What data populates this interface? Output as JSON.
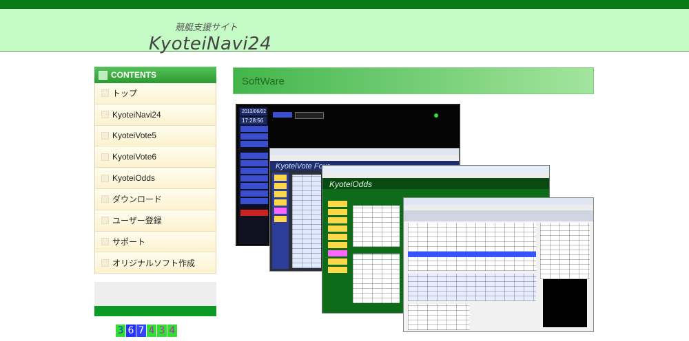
{
  "header": {
    "subtitle": "競艇支援サイト",
    "title": "KyoteiNavi24"
  },
  "sidebar": {
    "heading": "CONTENTS",
    "items": [
      {
        "label": "トップ"
      },
      {
        "label": "KyoteiNavi24"
      },
      {
        "label": "KyoteiVote5"
      },
      {
        "label": "KyoteiVote6"
      },
      {
        "label": "KyoteiOdds"
      },
      {
        "label": "ダウンロード"
      },
      {
        "label": "ユーザー登録"
      },
      {
        "label": "サポート"
      },
      {
        "label": "オリジナルソフト作成"
      }
    ]
  },
  "counter": {
    "digits": [
      "3",
      "6",
      "7",
      "4",
      "3",
      "4"
    ]
  },
  "main": {
    "section_title": "SoftWare",
    "screens": {
      "vote": {
        "logo": "KyoteiVote Four"
      },
      "odds": {
        "logo": "KyoteiOdds"
      },
      "navi": {
        "time": "17:28:56"
      }
    }
  },
  "colors": {
    "top_bar": "#0a7a18",
    "header_bg": "#c4fac4",
    "sidebar_head": "#2c9a30",
    "section_head": "#43b54b"
  }
}
